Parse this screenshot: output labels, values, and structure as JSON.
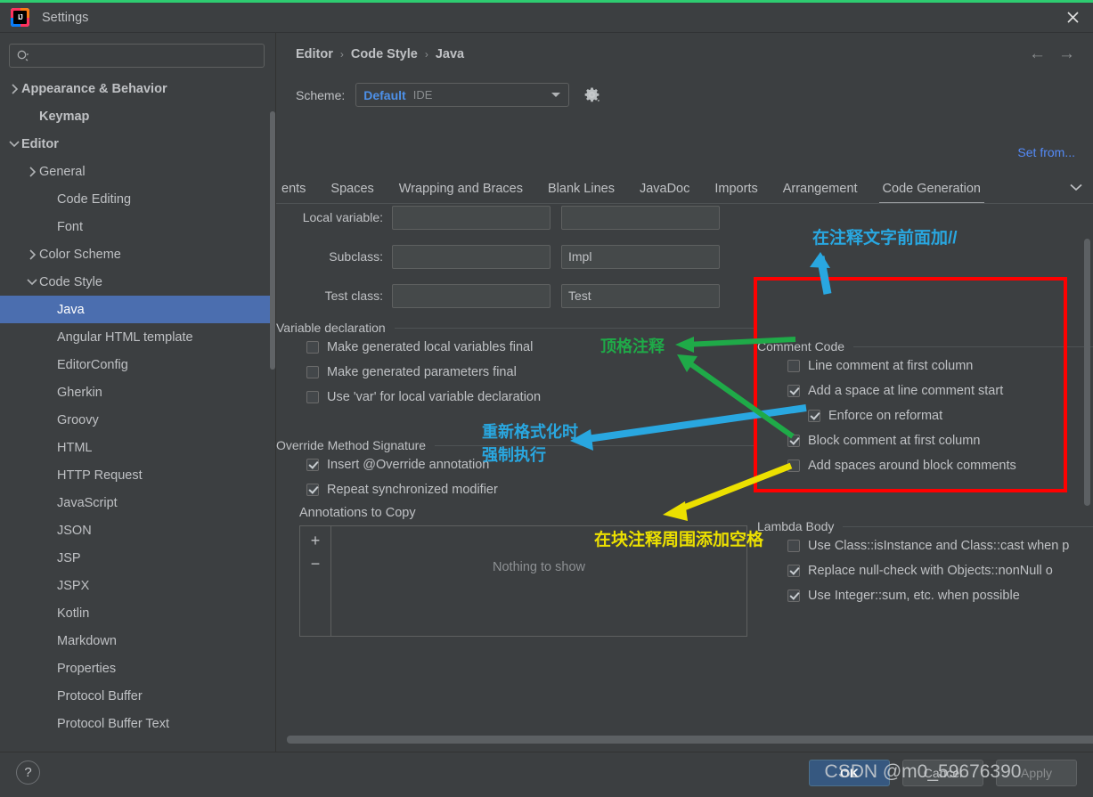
{
  "window": {
    "title": "Settings",
    "close_icon": "close-icon",
    "logo_text": "IJ"
  },
  "sidebar": {
    "search": {
      "placeholder": "",
      "value": "",
      "icon": "search-icon"
    },
    "items": [
      {
        "label": "Appearance & Behavior",
        "depth": 0,
        "arrow": "right",
        "bold": true,
        "selected": false
      },
      {
        "label": "Keymap",
        "depth": 1,
        "arrow": "",
        "bold": true,
        "selected": false
      },
      {
        "label": "Editor",
        "depth": 0,
        "arrow": "down",
        "bold": true,
        "selected": false
      },
      {
        "label": "General",
        "depth": 1,
        "arrow": "right",
        "bold": false,
        "selected": false
      },
      {
        "label": "Code Editing",
        "depth": 2,
        "arrow": "",
        "bold": false,
        "selected": false
      },
      {
        "label": "Font",
        "depth": 2,
        "arrow": "",
        "bold": false,
        "selected": false
      },
      {
        "label": "Color Scheme",
        "depth": 1,
        "arrow": "right",
        "bold": false,
        "selected": false
      },
      {
        "label": "Code Style",
        "depth": 1,
        "arrow": "down",
        "bold": false,
        "selected": false
      },
      {
        "label": "Java",
        "depth": 2,
        "arrow": "",
        "bold": false,
        "selected": true
      },
      {
        "label": "Angular HTML template",
        "depth": 2,
        "arrow": "",
        "bold": false,
        "selected": false
      },
      {
        "label": "EditorConfig",
        "depth": 2,
        "arrow": "",
        "bold": false,
        "selected": false
      },
      {
        "label": "Gherkin",
        "depth": 2,
        "arrow": "",
        "bold": false,
        "selected": false
      },
      {
        "label": "Groovy",
        "depth": 2,
        "arrow": "",
        "bold": false,
        "selected": false
      },
      {
        "label": "HTML",
        "depth": 2,
        "arrow": "",
        "bold": false,
        "selected": false
      },
      {
        "label": "HTTP Request",
        "depth": 2,
        "arrow": "",
        "bold": false,
        "selected": false
      },
      {
        "label": "JavaScript",
        "depth": 2,
        "arrow": "",
        "bold": false,
        "selected": false
      },
      {
        "label": "JSON",
        "depth": 2,
        "arrow": "",
        "bold": false,
        "selected": false
      },
      {
        "label": "JSP",
        "depth": 2,
        "arrow": "",
        "bold": false,
        "selected": false
      },
      {
        "label": "JSPX",
        "depth": 2,
        "arrow": "",
        "bold": false,
        "selected": false
      },
      {
        "label": "Kotlin",
        "depth": 2,
        "arrow": "",
        "bold": false,
        "selected": false
      },
      {
        "label": "Markdown",
        "depth": 2,
        "arrow": "",
        "bold": false,
        "selected": false
      },
      {
        "label": "Properties",
        "depth": 2,
        "arrow": "",
        "bold": false,
        "selected": false
      },
      {
        "label": "Protocol Buffer",
        "depth": 2,
        "arrow": "",
        "bold": false,
        "selected": false
      },
      {
        "label": "Protocol Buffer Text",
        "depth": 2,
        "arrow": "",
        "bold": false,
        "selected": false
      }
    ]
  },
  "header": {
    "breadcrumb": [
      "Editor",
      "Code Style",
      "Java"
    ],
    "separator": "›",
    "back_arrow": "←",
    "forward_arrow": "→",
    "scheme_label": "Scheme:",
    "scheme_value": "Default",
    "scheme_scope": "IDE",
    "gear_icon": "gear-icon",
    "set_from_label": "Set from..."
  },
  "tabs": {
    "items": [
      {
        "label": "ents",
        "active": false,
        "clipped": true
      },
      {
        "label": "Spaces",
        "active": false,
        "clipped": false
      },
      {
        "label": "Wrapping and Braces",
        "active": false,
        "clipped": false
      },
      {
        "label": "Blank Lines",
        "active": false,
        "clipped": false
      },
      {
        "label": "JavaDoc",
        "active": false,
        "clipped": false
      },
      {
        "label": "Imports",
        "active": false,
        "clipped": false
      },
      {
        "label": "Arrangement",
        "active": false,
        "clipped": false
      },
      {
        "label": "Code Generation",
        "active": true,
        "clipped": false
      }
    ],
    "overflow_icon": "chevron-down-icon"
  },
  "naming_fields": [
    {
      "label": "Local variable:",
      "prefix": "",
      "suffix": ""
    },
    {
      "label": "Subclass:",
      "prefix": "",
      "suffix": "Impl"
    },
    {
      "label": "Test class:",
      "prefix": "",
      "suffix": "Test"
    }
  ],
  "variable_declaration": {
    "title": "Variable declaration",
    "options": [
      {
        "label": "Make generated local variables final",
        "checked": false,
        "indent": false
      },
      {
        "label": "Make generated parameters final",
        "checked": false,
        "indent": false
      },
      {
        "label": "Use 'var' for local variable declaration",
        "checked": false,
        "indent": false
      }
    ]
  },
  "comment_code": {
    "title": "Comment Code",
    "options": [
      {
        "label": "Line comment at first column",
        "checked": false,
        "indent": false
      },
      {
        "label": "Add a space at line comment start",
        "checked": true,
        "indent": false
      },
      {
        "label": "Enforce on reformat",
        "checked": true,
        "indent": true
      },
      {
        "label": "Block comment at first column",
        "checked": true,
        "indent": false
      },
      {
        "label": "Add spaces around block comments",
        "checked": false,
        "indent": false
      }
    ]
  },
  "override_method_signature": {
    "title": "Override Method Signature",
    "options": [
      {
        "label": "Insert @Override annotation",
        "checked": true,
        "indent": false
      },
      {
        "label": "Repeat synchronized modifier",
        "checked": true,
        "indent": false
      }
    ],
    "annotations_label": "Annotations to Copy",
    "add_icon": "plus-icon",
    "remove_icon": "minus-icon",
    "empty_text": "Nothing to show"
  },
  "lambda_body": {
    "title": "Lambda Body",
    "options": [
      {
        "label": "Use Class::isInstance and Class::cast when p",
        "checked": false,
        "indent": false
      },
      {
        "label": "Replace null-check with Objects::nonNull o",
        "checked": true,
        "indent": false
      },
      {
        "label": "Use Integer::sum, etc. when possible",
        "checked": true,
        "indent": false
      }
    ]
  },
  "footer": {
    "help_label": "?",
    "ok_label": "OK",
    "cancel_label": "Cancel",
    "apply_label": "Apply"
  },
  "annotations": {
    "blue_top": "在注释文字前面加//",
    "green_left": "顶格注释",
    "blue_left_line1": "重新格式化时",
    "blue_left_line2": "强制执行",
    "yellow_bottom": "在块注释周围添加空格",
    "colors": {
      "blue": "#29a7e0",
      "green": "#1faa48",
      "yellow": "#ece000",
      "red_box": "#ff0000"
    }
  },
  "watermark": "CSDN @m0_59676390"
}
